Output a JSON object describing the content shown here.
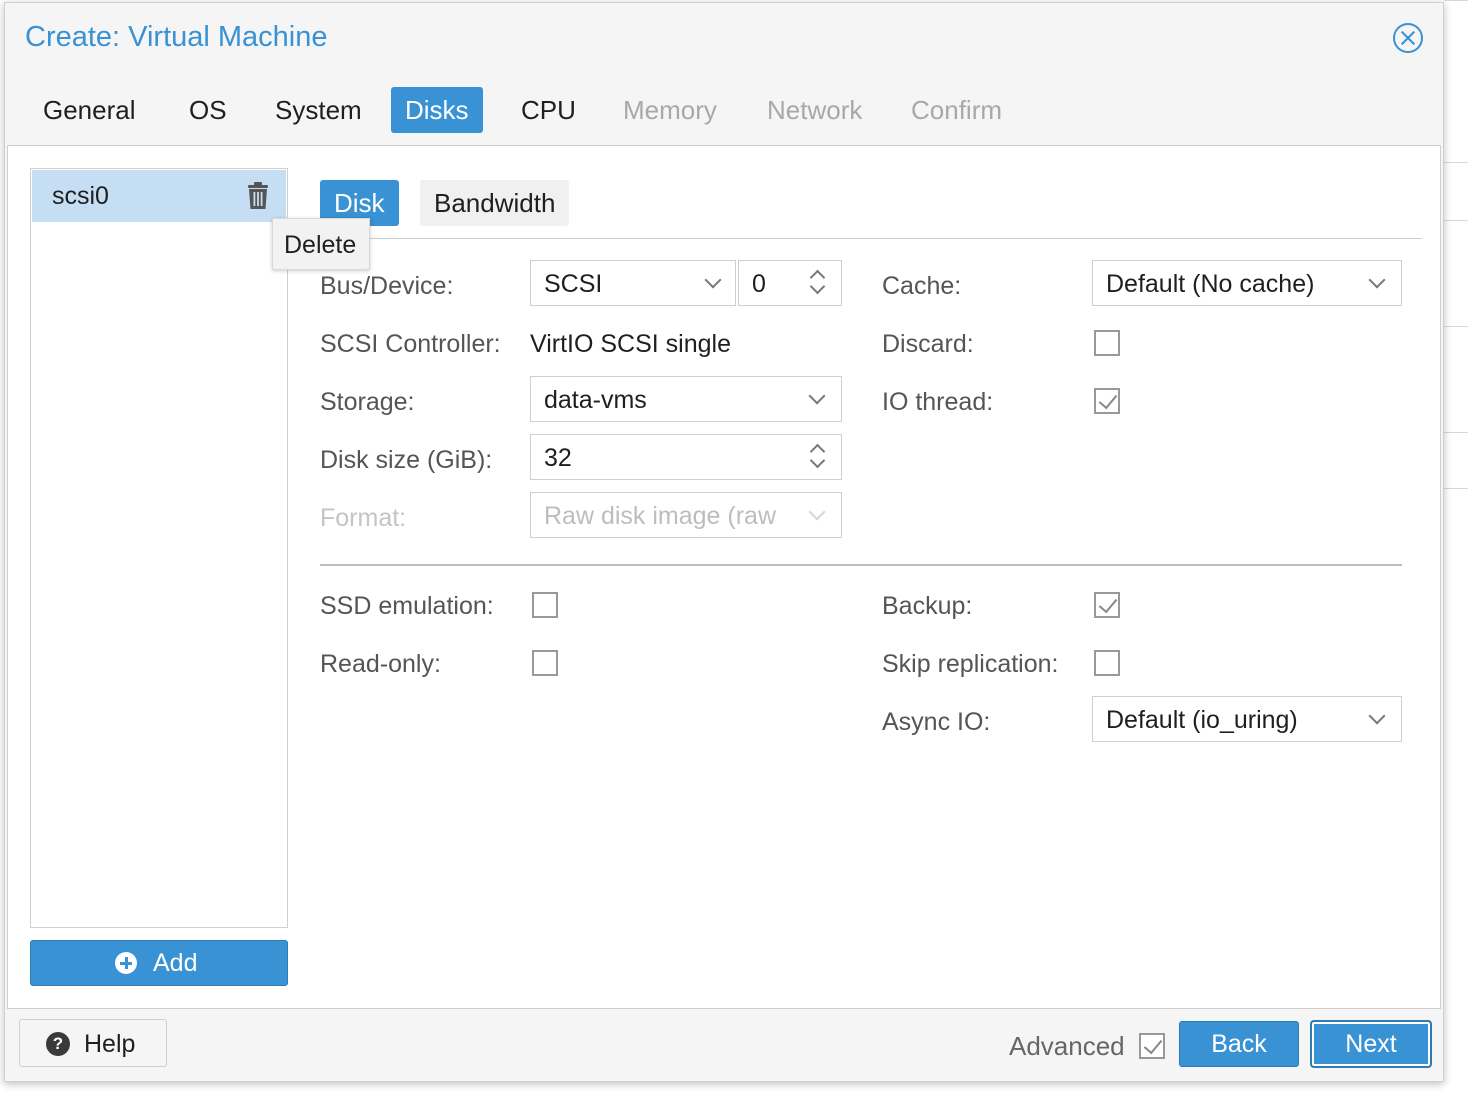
{
  "dialog": {
    "title": "Create: Virtual Machine"
  },
  "tabs": [
    {
      "label": "General",
      "state": "enabled"
    },
    {
      "label": "OS",
      "state": "enabled"
    },
    {
      "label": "System",
      "state": "enabled"
    },
    {
      "label": "Disks",
      "state": "active"
    },
    {
      "label": "CPU",
      "state": "enabled"
    },
    {
      "label": "Memory",
      "state": "disabled"
    },
    {
      "label": "Network",
      "state": "disabled"
    },
    {
      "label": "Confirm",
      "state": "disabled"
    }
  ],
  "disk_list": {
    "items": [
      {
        "label": "scsi0",
        "selected": true
      }
    ],
    "delete_tooltip": "Delete",
    "add_label": "Add"
  },
  "subtabs": [
    {
      "label": "Disk",
      "active": true
    },
    {
      "label": "Bandwidth",
      "active": false
    }
  ],
  "form": {
    "bus_device": {
      "label": "Bus/Device:",
      "bus": "SCSI",
      "index": "0"
    },
    "scsi_controller": {
      "label": "SCSI Controller:",
      "value": "VirtIO SCSI single"
    },
    "storage": {
      "label": "Storage:",
      "value": "data-vms"
    },
    "disk_size": {
      "label": "Disk size (GiB):",
      "value": "32"
    },
    "format": {
      "label": "Format:",
      "value": "Raw disk image (raw"
    },
    "cache": {
      "label": "Cache:",
      "value": "Default (No cache)"
    },
    "discard": {
      "label": "Discard:",
      "checked": false
    },
    "io_thread": {
      "label": "IO thread:",
      "checked": true
    },
    "ssd_emulation": {
      "label": "SSD emulation:",
      "checked": false
    },
    "read_only": {
      "label": "Read-only:",
      "checked": false
    },
    "backup": {
      "label": "Backup:",
      "checked": true
    },
    "skip_replication": {
      "label": "Skip replication:",
      "checked": false
    },
    "async_io": {
      "label": "Async IO:",
      "value": "Default (io_uring)"
    }
  },
  "footer": {
    "help_label": "Help",
    "advanced_label": "Advanced",
    "advanced_checked": true,
    "back_label": "Back",
    "next_label": "Next"
  },
  "colors": {
    "accent": "#3892d4",
    "selection": "#c5def4"
  }
}
